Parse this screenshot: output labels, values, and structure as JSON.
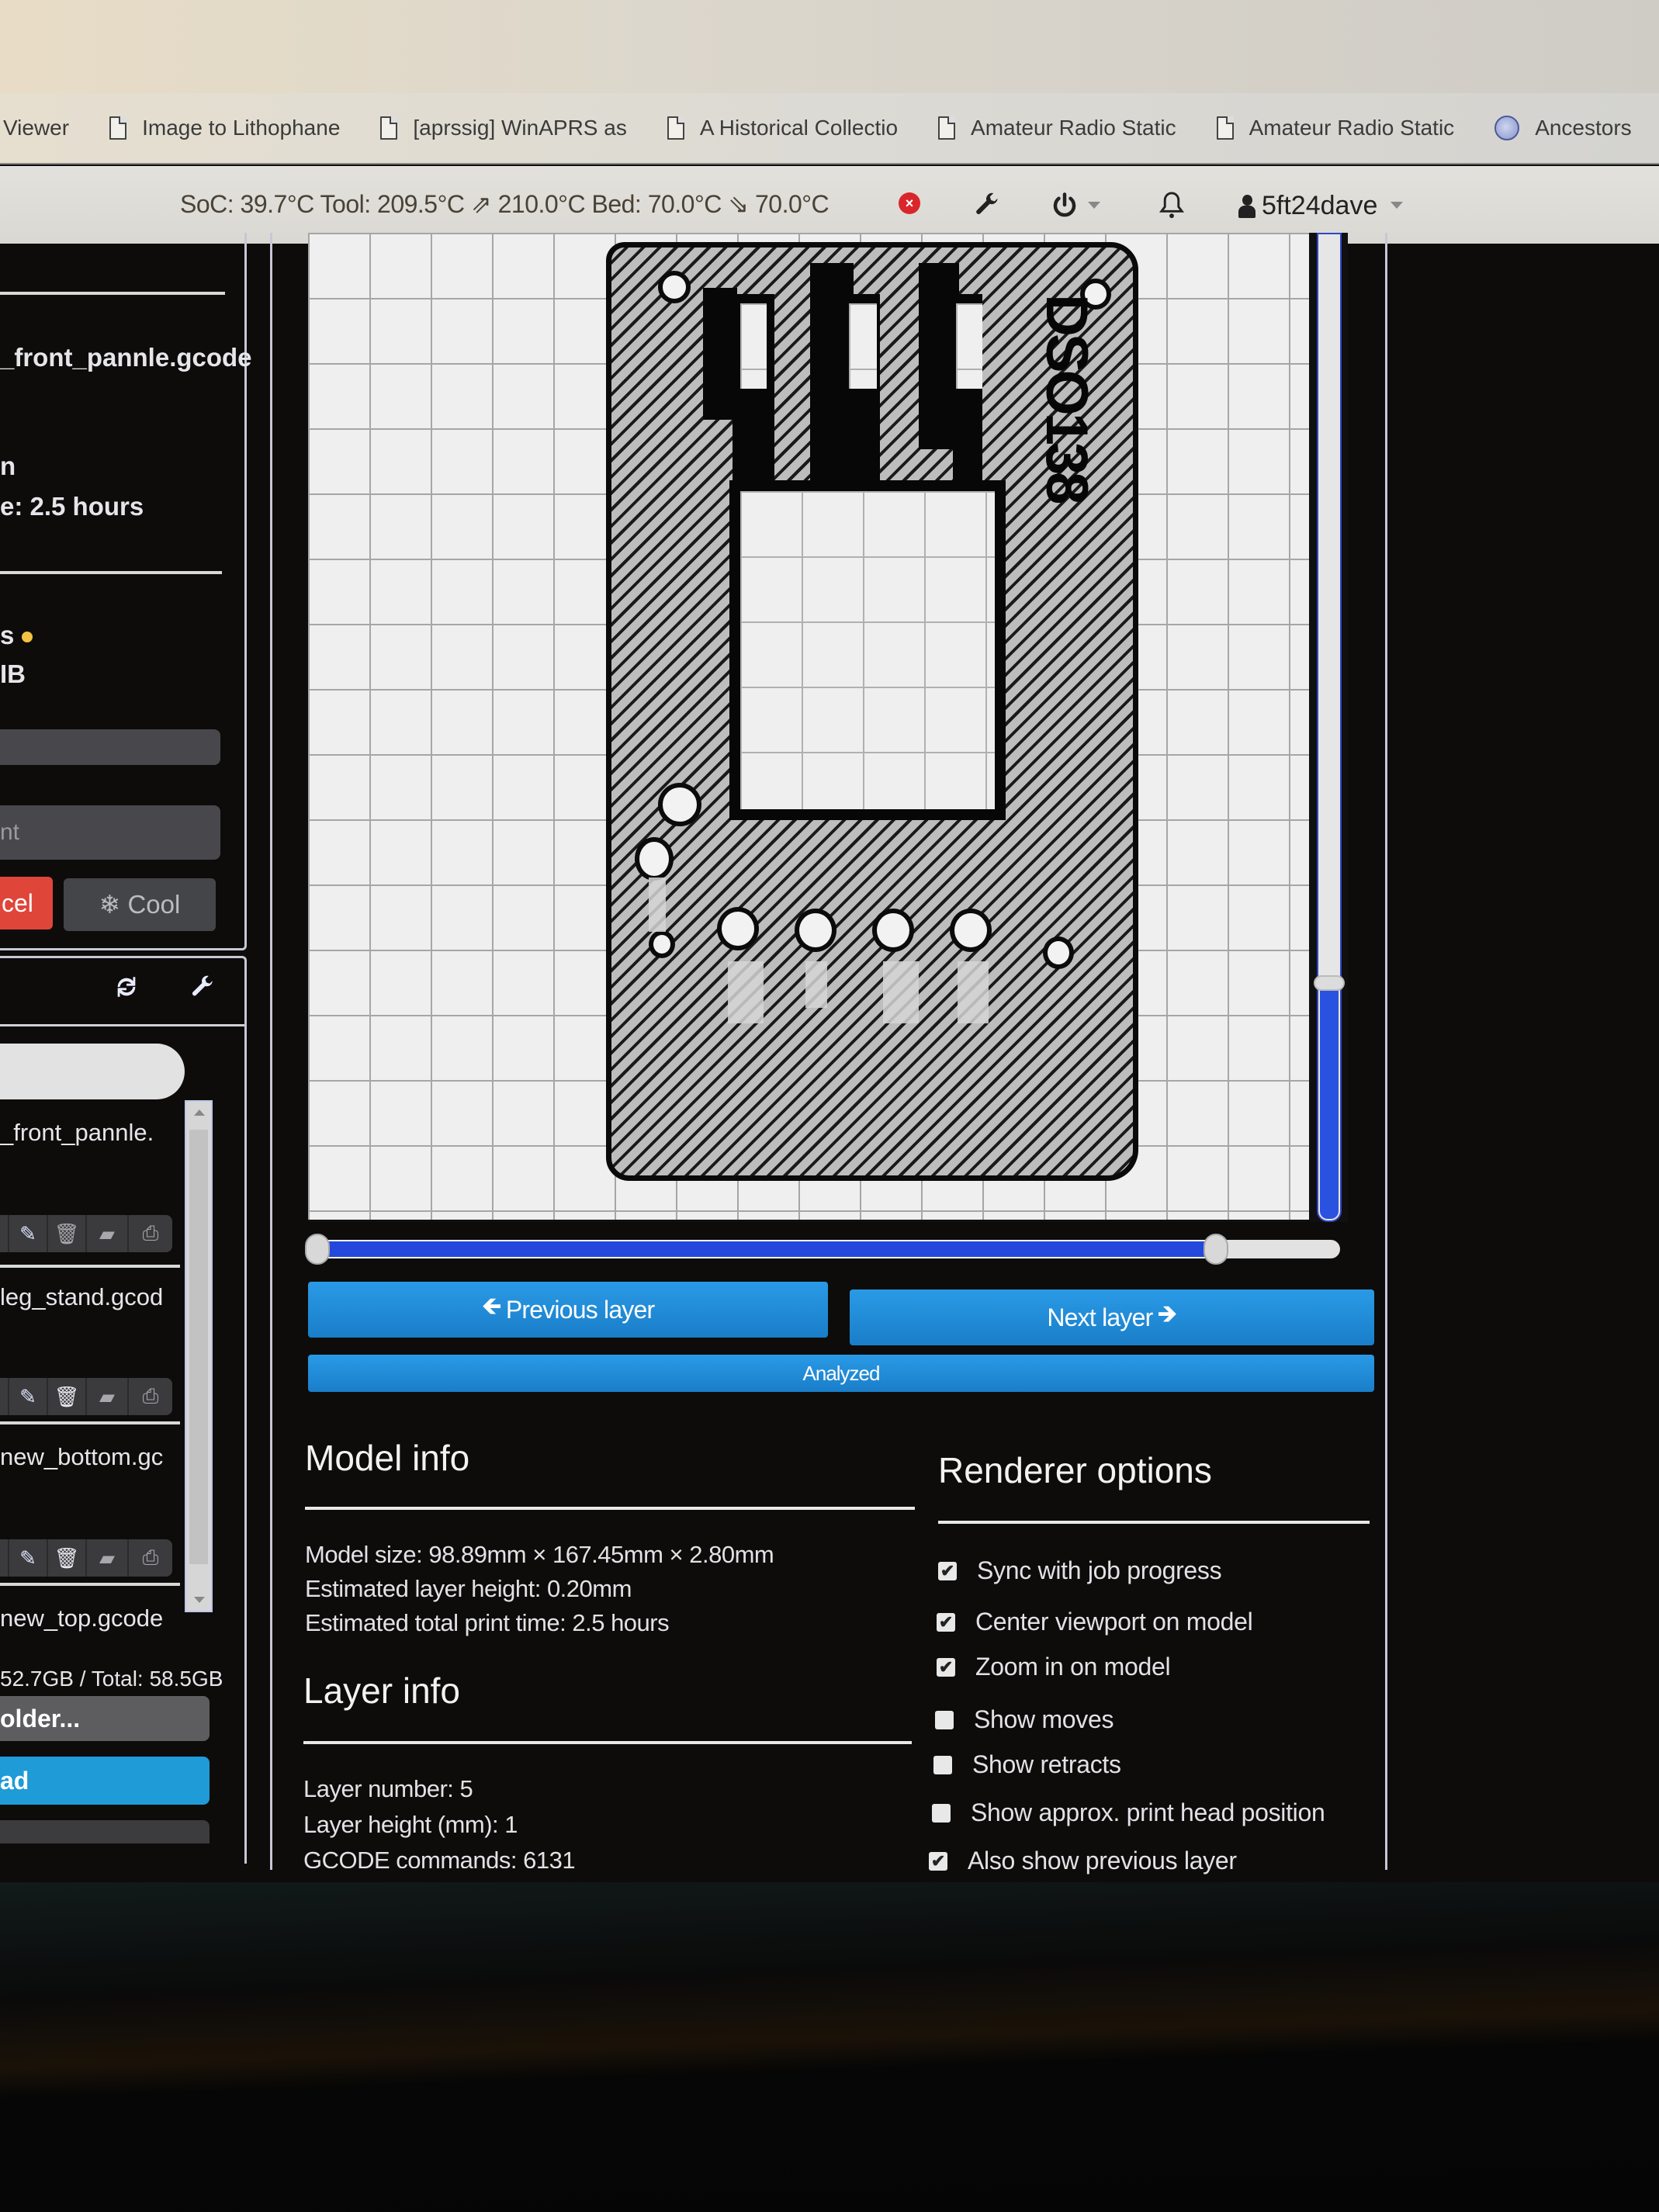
{
  "browser": {
    "bookmarks": [
      {
        "label": "Viewer",
        "icon": "none"
      },
      {
        "label": "Image to Lithophane",
        "icon": "document-icon"
      },
      {
        "label": "[aprssig] WinAPRS as",
        "icon": "document-icon"
      },
      {
        "label": "A Historical Collectio",
        "icon": "document-icon"
      },
      {
        "label": "Amateur Radio Static",
        "icon": "document-icon"
      },
      {
        "label": "Amateur Radio Static",
        "icon": "document-icon"
      },
      {
        "label": "Ancestors",
        "icon": "globe-icon"
      }
    ]
  },
  "navbar": {
    "temperatures": "SoC: 39.7°C Tool: 209.5°C ⇗ 210.0°C Bed: 70.0°C ⇘ 70.0°C",
    "error_icon": "×",
    "settings_icon": "wrench-icon",
    "power_icon": "power-icon",
    "notifications_icon": "bell-icon",
    "username": "5ft24dave"
  },
  "state_panel": {
    "file_line": "_front_pannle.gcode",
    "line_a": "n",
    "print_time_line": "e: 2.5 hours",
    "status_line": "s",
    "size_line": "IB",
    "progress_placeholder": "",
    "print_button_partial": "nt",
    "cancel_label": "cel",
    "cool_label": "Cool",
    "cool_icon": "❄"
  },
  "files_panel": {
    "refresh_icon": "refresh-icon",
    "settings_icon": "wrench-icon",
    "search_value": "",
    "files": [
      {
        "name": "_front_pannle."
      },
      {
        "name": "leg_stand.gcod"
      },
      {
        "name": "new_bottom.gc"
      },
      {
        "name": "new_top.gcode"
      }
    ],
    "actions": [
      "load",
      "edit",
      "delete",
      "select",
      "print"
    ],
    "storage": "52.7GB / Total: 58.5GB",
    "create_folder_label": "older...",
    "upload_label": "ad"
  },
  "gcode_viewer": {
    "model_label": "DSO138",
    "layer_slider": {
      "min_fraction": 0.0,
      "max_fraction": 0.88
    },
    "vertical_slider": {
      "fraction": 0.24
    },
    "previous_layer_label": "Previous layer",
    "next_layer_label": "Next layer",
    "analyzed_label": "Analyzed"
  },
  "model_info": {
    "title": "Model info",
    "lines": [
      "Model size: 98.89mm × 167.45mm × 2.80mm",
      "Estimated layer height: 0.20mm",
      "Estimated total print time: 2.5 hours"
    ]
  },
  "layer_info": {
    "title": "Layer info",
    "lines": [
      "Layer number: 5",
      "Layer height (mm): 1",
      "GCODE commands: 6131"
    ]
  },
  "renderer_options": {
    "title": "Renderer options",
    "options": [
      {
        "label": "Sync with job progress",
        "checked": true
      },
      {
        "label": "Center viewport on model",
        "checked": true
      },
      {
        "label": "Zoom in on model",
        "checked": true
      },
      {
        "label": "Show moves",
        "checked": false
      },
      {
        "label": "Show retracts",
        "checked": false
      },
      {
        "label": "Show approx. print head position",
        "checked": false
      },
      {
        "label": "Also show previous layer",
        "checked": true
      }
    ]
  }
}
